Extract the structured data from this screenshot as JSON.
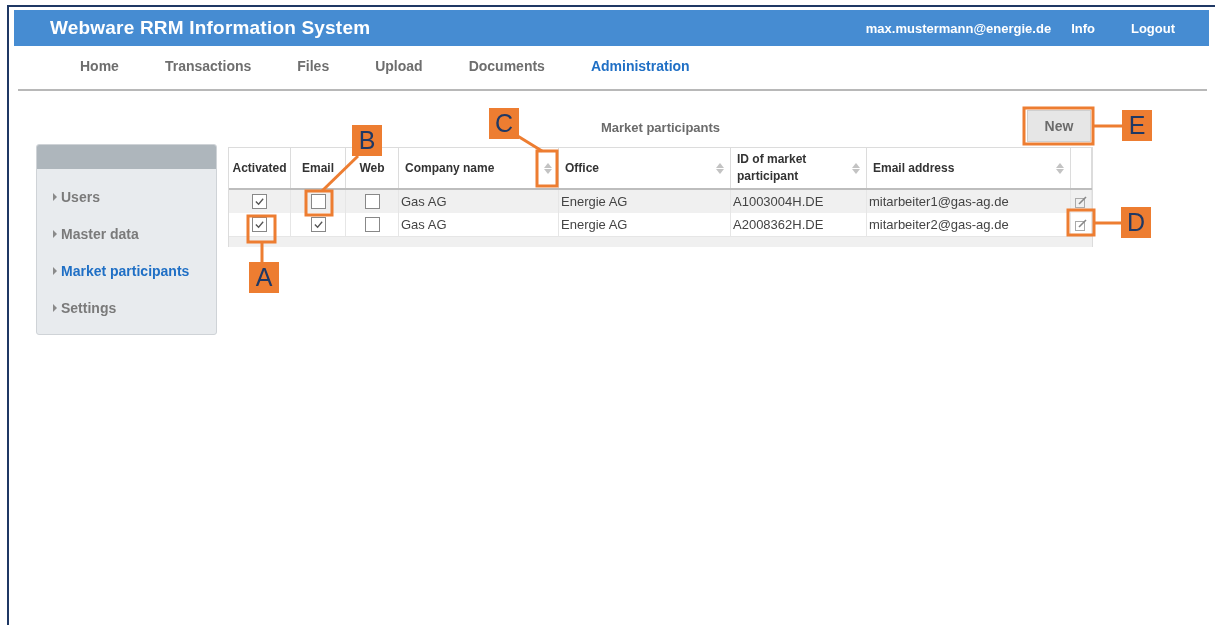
{
  "header": {
    "title": "Webware RRM Information System",
    "user": "max.mustermann@energie.de",
    "links": [
      "Info",
      "Logout"
    ]
  },
  "nav": [
    {
      "label": "Home",
      "selected": false
    },
    {
      "label": "Transactions",
      "selected": false
    },
    {
      "label": "Files",
      "selected": false
    },
    {
      "label": "Upload",
      "selected": false
    },
    {
      "label": "Documents",
      "selected": false
    },
    {
      "label": "Administration",
      "selected": true
    }
  ],
  "sidebar": {
    "items": [
      {
        "label": "Users",
        "selected": false
      },
      {
        "label": "Master data",
        "selected": false
      },
      {
        "label": "Market participants",
        "selected": true
      },
      {
        "label": "Settings",
        "selected": false
      }
    ]
  },
  "main": {
    "title": "Market participants",
    "new_button": "New"
  },
  "table": {
    "columns": [
      {
        "label": "Activated",
        "sortable": false
      },
      {
        "label": "Email",
        "sortable": false
      },
      {
        "label": "Web",
        "sortable": false
      },
      {
        "label": "Company name",
        "sortable": true
      },
      {
        "label": "Office",
        "sortable": true
      },
      {
        "label": "ID of market participant",
        "sortable": true
      },
      {
        "label": "Email address",
        "sortable": true
      }
    ],
    "rows": [
      {
        "activated": true,
        "email": false,
        "web": false,
        "company": "Gas AG",
        "office": "Energie AG",
        "participant_id": "A1003004H.DE",
        "email_address": "mitarbeiter1@gas-ag.de"
      },
      {
        "activated": true,
        "email": true,
        "web": false,
        "company": "Gas AG",
        "office": "Energie AG",
        "participant_id": "A2008362H.DE",
        "email_address": "mitarbeiter2@gas-ag.de"
      }
    ]
  },
  "callouts": [
    {
      "label": "A"
    },
    {
      "label": "B"
    },
    {
      "label": "C"
    },
    {
      "label": "D"
    },
    {
      "label": "E"
    }
  ]
}
